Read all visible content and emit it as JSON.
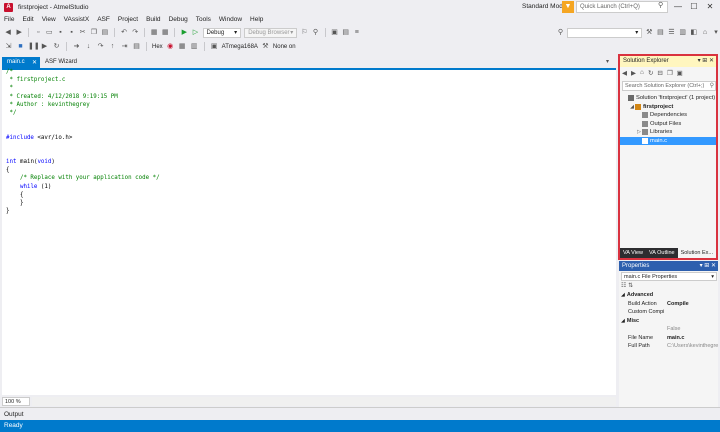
{
  "window": {
    "title": "firstproject - AtmelStudio",
    "icon_letter": "A",
    "mode": "Standard Mode",
    "quick_launch_placeholder": "Quick Launch (Ctrl+Q)",
    "min": "—",
    "max": "☐",
    "close": "✕"
  },
  "menu": [
    "File",
    "Edit",
    "View",
    "VAssistX",
    "ASF",
    "Project",
    "Build",
    "Debug",
    "Tools",
    "Window",
    "Help"
  ],
  "toolbar1": {
    "config": "Debug",
    "debug_browser": "Debug Browser"
  },
  "toolbar2": {
    "hex": "Hex",
    "device": "ATmega168A",
    "tool": "None on"
  },
  "doc_tabs": {
    "main": "main.c",
    "asf": "ASF Wizard",
    "dropdown": "▾"
  },
  "editor": {
    "lines": [
      {
        "t": "/*",
        "c": "cmt"
      },
      {
        "t": " * firstproject.c",
        "c": "cmt"
      },
      {
        "t": " *",
        "c": "cmt"
      },
      {
        "t": " * Created: 4/12/2018 9:19:15 PM",
        "c": "cmt"
      },
      {
        "t": " * Author : kevinthegrey",
        "c": "cmt"
      },
      {
        "t": " */",
        "c": "cmt"
      },
      {
        "t": "",
        "c": "plain"
      },
      {
        "t": "",
        "c": "plain"
      },
      {
        "t": "#include <avr/io.h>",
        "c": "pp"
      },
      {
        "t": "",
        "c": "plain"
      },
      {
        "t": "",
        "c": "plain"
      },
      {
        "t": "int main(void)",
        "c": "kwline"
      },
      {
        "t": "{",
        "c": "plain"
      },
      {
        "t": "    /* Replace with your application code */",
        "c": "cmt"
      },
      {
        "t": "    while (1)",
        "c": "kwline2"
      },
      {
        "t": "    {",
        "c": "plain"
      },
      {
        "t": "    }",
        "c": "plain"
      },
      {
        "t": "}",
        "c": "plain"
      }
    ],
    "zoom": "100 %"
  },
  "solution_explorer": {
    "title": "Solution Explorer",
    "title_buttons": "▾ ⊞ ✕",
    "search_placeholder": "Search Solution Explorer (Ctrl+;)",
    "tree": [
      {
        "label": "Solution 'firstproject' (1 project)",
        "indent": 0,
        "glyph": "",
        "bold": false
      },
      {
        "label": "firstproject",
        "indent": 1,
        "glyph": "◢",
        "bold": true
      },
      {
        "label": "Dependencies",
        "indent": 2,
        "glyph": "",
        "bold": false
      },
      {
        "label": "Output Files",
        "indent": 2,
        "glyph": "",
        "bold": false
      },
      {
        "label": "Libraries",
        "indent": 2,
        "glyph": "▷",
        "bold": false
      },
      {
        "label": "main.c",
        "indent": 2,
        "glyph": "",
        "bold": false,
        "selected": true
      }
    ],
    "bottom_tabs": [
      "VA View",
      "VA Outline",
      "Solution Ex..."
    ]
  },
  "properties": {
    "title": "Properties",
    "title_buttons": "▾ ⊞ ✕",
    "object": "main.c File Properties",
    "rows": [
      {
        "type": "cat",
        "name": "Advanced"
      },
      {
        "type": "prop",
        "name": "Build Action",
        "value": "Compile",
        "bold": true
      },
      {
        "type": "prop",
        "name": "Custom Compi",
        "value": ""
      },
      {
        "type": "cat",
        "name": "Misc"
      },
      {
        "type": "prop",
        "name": "",
        "value": "False",
        "grey": true
      },
      {
        "type": "prop",
        "name": "File Name",
        "value": "main.c",
        "bold": true
      },
      {
        "type": "prop",
        "name": "Full Path",
        "value": "C:\\Users\\kevinthegre",
        "grey": true
      }
    ]
  },
  "output": {
    "label": "Output"
  },
  "status": {
    "text": "Ready"
  },
  "colors": {
    "accent": "#007acc",
    "highlight_border": "#d9323f"
  }
}
